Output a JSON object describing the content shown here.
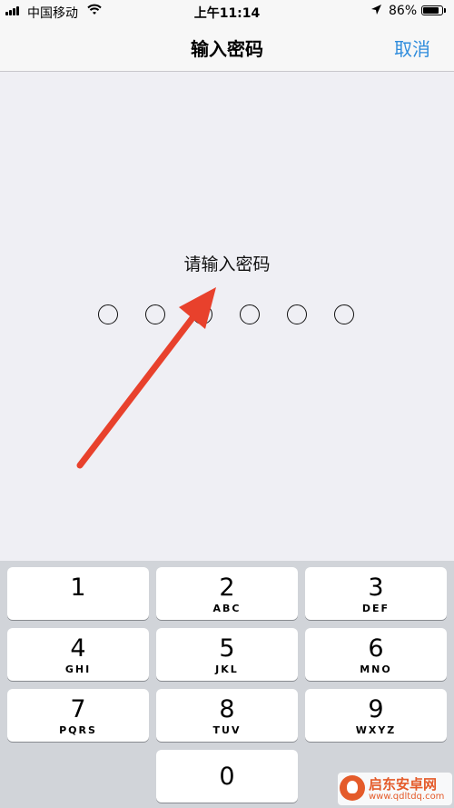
{
  "status_bar": {
    "carrier": "中国移动",
    "wifi_icon": "wifi-icon",
    "time": "上午11:14",
    "location_icon": "location-arrow-icon",
    "battery_percent": "86%",
    "battery_level": 0.86
  },
  "nav": {
    "title": "输入密码",
    "cancel_label": "取消",
    "accent_color": "#2f8cdc"
  },
  "passcode": {
    "prompt": "请输入密码",
    "digits_total": 6,
    "digits_entered": 0
  },
  "annotation": {
    "arrow_color": "#e8412c"
  },
  "keypad": {
    "keys": [
      {
        "num": "1",
        "letters": ""
      },
      {
        "num": "2",
        "letters": "ABC"
      },
      {
        "num": "3",
        "letters": "DEF"
      },
      {
        "num": "4",
        "letters": "GHI"
      },
      {
        "num": "5",
        "letters": "JKL"
      },
      {
        "num": "6",
        "letters": "MNO"
      },
      {
        "num": "7",
        "letters": "PQRS"
      },
      {
        "num": "8",
        "letters": "TUV"
      },
      {
        "num": "9",
        "letters": "WXYZ"
      },
      {
        "num": "0",
        "letters": ""
      }
    ]
  },
  "watermark": {
    "title": "启东安卓网",
    "url": "www.qdltdq.com"
  }
}
